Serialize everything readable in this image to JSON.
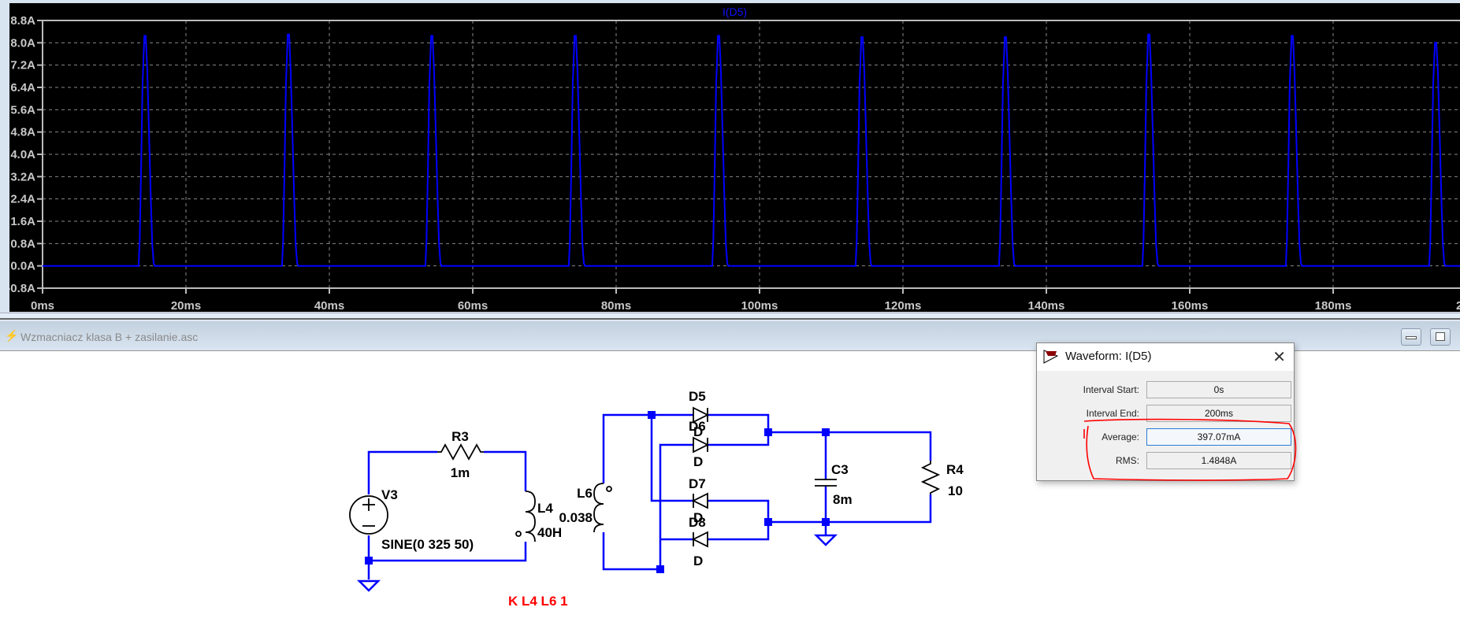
{
  "plot": {
    "title": "I(D5)",
    "background": "#000000",
    "trace_color": "#0000ff"
  },
  "chart_data": {
    "type": "line",
    "title": "I(D5)",
    "xlabel": "",
    "ylabel": "",
    "xlim": [
      0,
      200
    ],
    "ylim": [
      -0.8,
      8.8
    ],
    "x_ticks": [
      "0ms",
      "20ms",
      "40ms",
      "60ms",
      "80ms",
      "100ms",
      "120ms",
      "140ms",
      "160ms",
      "180ms",
      "2"
    ],
    "y_ticks": [
      "8.8A",
      "8.0A",
      "7.2A",
      "6.4A",
      "5.6A",
      "4.8A",
      "4.0A",
      "3.2A",
      "2.4A",
      "1.6A",
      "0.8A",
      "0.0A",
      "-0.8A"
    ],
    "grid": true,
    "series": [
      {
        "color": "#0000ff",
        "peak_times_ms": [
          14.3,
          34.3,
          54.3,
          74.3,
          94.3,
          114.3,
          134.3,
          154.3,
          174.3,
          194.3
        ],
        "peak_values_A": [
          8.25,
          8.3,
          8.25,
          8.25,
          8.25,
          8.2,
          8.2,
          8.3,
          8.25,
          8.0
        ],
        "baseline_A": 0.0
      }
    ]
  },
  "schematic": {
    "title": "Wzmacniacz klasa B + zasilanie.asc",
    "labels": {
      "v3": "V3",
      "v3_value": "SINE(0 325 50)",
      "r3": "R3",
      "r3_value": "1m",
      "l4": "L4",
      "l4_value": "40H",
      "l6": "L6",
      "l6_value": "0.038",
      "d5": "D5",
      "d5_value": "D",
      "d6": "D6",
      "d6_value": "D",
      "d7": "D7",
      "d7_value": "D",
      "d8": "D8",
      "d8_value": "D",
      "c3": "C3",
      "c3_value": "8m",
      "r4": "R4",
      "r4_value": "10",
      "directive": "K L4 L6 1"
    },
    "wire_color": "#0000ff",
    "directive_color": "#ff0000"
  },
  "dialog": {
    "title": "Waveform: I(D5)",
    "close": "✕",
    "rows": [
      {
        "label": "Interval Start:",
        "value": "0s"
      },
      {
        "label": "Interval End:",
        "value": "200ms"
      },
      {
        "label": "Average:",
        "value": "397.07mA"
      },
      {
        "label": "RMS:",
        "value": "1.4848A"
      }
    ],
    "annotation_color": "#ff0000"
  }
}
